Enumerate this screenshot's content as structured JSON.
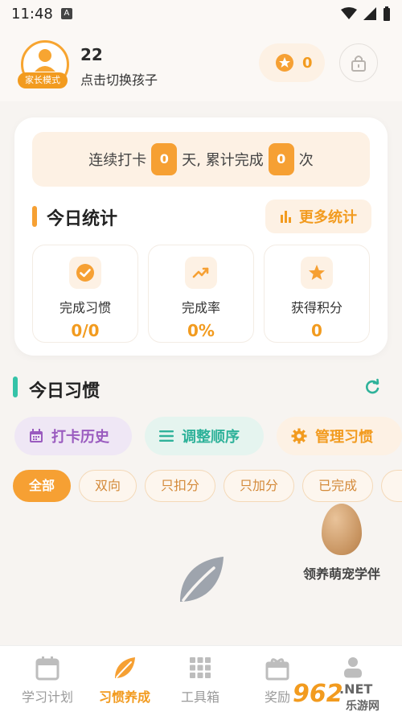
{
  "status_bar": {
    "time": "11:48",
    "a_badge": "A"
  },
  "header": {
    "parent_mode_badge": "家长模式",
    "child_name": "22",
    "switch_child_text": "点击切换孩子",
    "points": "0"
  },
  "stats": {
    "streak_prefix": "连续打卡",
    "streak_days": "0",
    "streak_mid": "天, 累计完成",
    "total_count": "0",
    "streak_suffix": "次",
    "title": "今日统计",
    "more_label": "更多统计",
    "tiles": [
      {
        "label": "完成习惯",
        "value": "0/0",
        "icon": "check-circle-icon"
      },
      {
        "label": "完成率",
        "value": "0%",
        "icon": "trend-up-icon"
      },
      {
        "label": "获得积分",
        "value": "0",
        "icon": "star-icon"
      }
    ]
  },
  "habits": {
    "title": "今日习惯",
    "actions": [
      {
        "label": "打卡历史",
        "icon": "calendar-icon"
      },
      {
        "label": "调整顺序",
        "icon": "list-icon"
      },
      {
        "label": "管理习惯",
        "icon": "gear-icon"
      }
    ],
    "filters": [
      "全部",
      "双向",
      "只扣分",
      "只加分",
      "已完成"
    ],
    "active_filter": "全部"
  },
  "pet": {
    "label": "领养萌宠学伴"
  },
  "nav": {
    "items": [
      {
        "label": "学习计划",
        "icon": "calendar-icon"
      },
      {
        "label": "习惯养成",
        "icon": "leaf-icon"
      },
      {
        "label": "工具箱",
        "icon": "grid-icon"
      },
      {
        "label": "奖励",
        "icon": "gift-icon"
      },
      {
        "label": "",
        "icon": "person-icon"
      }
    ],
    "active": "习惯养成"
  },
  "watermark": {
    "text1": "962",
    "text2": ".NET",
    "text3": "乐游网"
  },
  "colors": {
    "accent": "#f29b1f",
    "purple": "#9a5bbf",
    "teal": "#2fb29a",
    "background": "#f7f4f1"
  }
}
